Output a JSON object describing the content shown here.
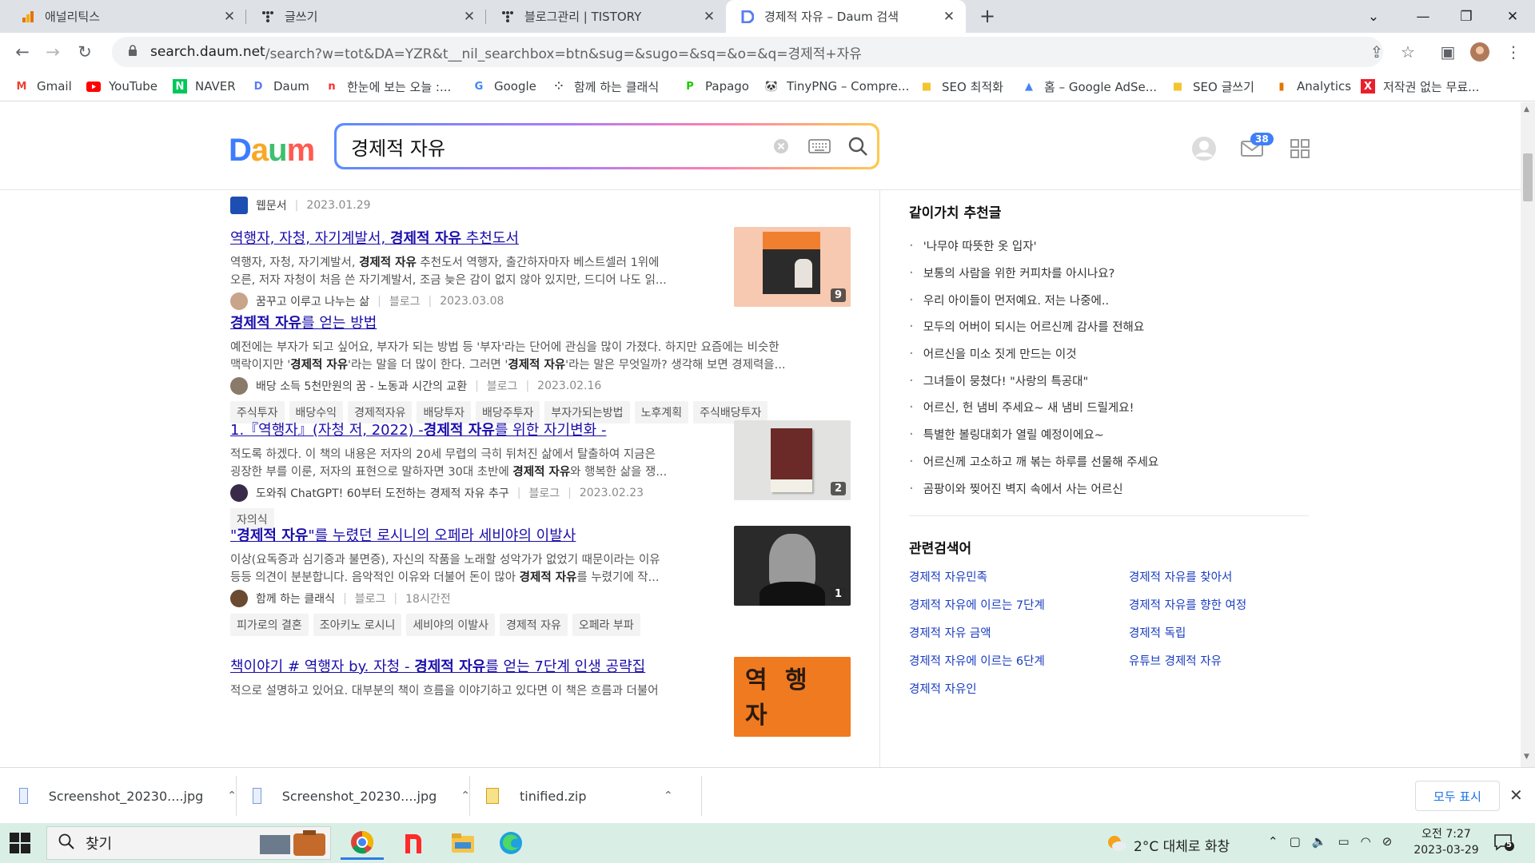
{
  "browser": {
    "tabs": [
      {
        "title": "애널리틱스",
        "active": false
      },
      {
        "title": "글쓰기",
        "active": false
      },
      {
        "title": "블로그관리 | TISTORY",
        "active": false
      },
      {
        "title": "경제적 자유 – Daum 검색",
        "active": true
      }
    ],
    "url_host": "search.daum.net",
    "url_rest": "/search?w=tot&DA=YZR&t__nil_searchbox=btn&sug=&sugo=&sq=&o=&q=경제적+자유",
    "bookmarks": [
      "Gmail",
      "YouTube",
      "NAVER",
      "Daum",
      "한눈에 보는 오늘 :...",
      "Google",
      "함께 하는 클래식",
      "Papago",
      "TinyPNG – Compre...",
      "SEO 최적화",
      "홈 – Google AdSe...",
      "SEO 글쓰기",
      "Analytics",
      "저작권 없는 무료..."
    ]
  },
  "daum": {
    "logo": "Daum",
    "query": "경제적 자유",
    "mail_count": "38"
  },
  "results": {
    "top_meta": {
      "source": "웹문서",
      "date": "2023.01.29"
    },
    "items": [
      {
        "title_pre": "역행자, 자청, 자기계발서, ",
        "title_bold": "경제적 자유",
        "title_post": " 추천도서",
        "desc_1_pre": "역행자, 자청, 자기계발서, ",
        "desc_1_bold": "경제적 자유",
        "desc_1_post": " 추천도서 역행자, 출간하자마자 베스트셀러 1위에",
        "desc_2": "오른, 저자 자청이 처음 쓴 자기계발서, 조금 늦은 감이 없지 않아 있지만, 드디어 나도 읽...",
        "author": "꿈꾸고 이루고 나누는 삶",
        "type": "블로그",
        "date": "2023.03.08",
        "count": "9"
      },
      {
        "title_bold": "경제적 자유",
        "title_post": "를 얻는 방법",
        "desc_1": "예전에는 부자가 되고 싶어요, 부자가 되는 방법 등 '부자'라는 단어에 관심을 많이 가졌다. 하지만 요즘에는 비슷한",
        "desc_2_pre": "맥락이지만 '",
        "desc_2_bold": "경제적 자유",
        "desc_2_mid": "'라는 말을 더 많이 한다. 그러면 '",
        "desc_2_bold2": "경제적 자유",
        "desc_2_post": "'라는 말은 무엇일까? 생각해 보면 경제력을...",
        "author": "배당 소득 5천만원의 꿈 - 노동과 시간의 교환",
        "type": "블로그",
        "date": "2023.02.16",
        "tags": [
          "주식투자",
          "배당수익",
          "경제적자유",
          "배당투자",
          "배당주투자",
          "부자가되는방법",
          "노후계획",
          "주식배당투자"
        ]
      },
      {
        "title_pre": "1.『역행자』(자청 저, 2022) -",
        "title_bold": "경제적 자유",
        "title_post": "를 위한 자기변화 -",
        "desc_1": "적도록 하겠다. 이 책의 내용은 저자의 20세 무렵의 극히 뒤처진 삶에서 탈출하여 지금은",
        "desc_2_pre": "굉장한 부를 이룬, 저자의 표현으로 말하자면 30대 초반에 ",
        "desc_2_bold": "경제적 자유",
        "desc_2_post": "와 행복한 삶을 쟁...",
        "author": "도와줘 ChatGPT! 60부터 도전하는 경제적 자유 추구",
        "type": "블로그",
        "date": "2023.02.23",
        "count": "2",
        "tags": [
          "자의식"
        ]
      },
      {
        "title_pre": "\"",
        "title_bold": "경제적 자유",
        "title_post": "\"를 누렸던 로시니의 오페라 세비야의 이발사",
        "desc_1": "이상(요독증과 심기증과 불면증), 자신의 작품을 노래할 성악가가 없었기 때문이라는 이유",
        "desc_2_pre": "등등 의견이 분분합니다. 음악적인 이유와 더불어 돈이 많아 ",
        "desc_2_bold": "경제적 자유",
        "desc_2_post": "를 누렸기에 작...",
        "author": "함께 하는 클래식",
        "type": "블로그",
        "date": "18시간전",
        "count": "1",
        "tags": [
          "피가로의 결혼",
          "조아키노 로시니",
          "세비야의 이발사",
          "경제적 자유",
          "오페라 부파"
        ]
      },
      {
        "title_pre": "책이야기 # 역행자 by. 자청 - ",
        "title_bold": "경제적 자유",
        "title_post": "를 얻는 7단계 인생 공략집",
        "desc_1": "적으로 설명하고 있어요. 대부분의 책이 흐름을 이야기하고 있다면 이 책은 흐름과 더불어"
      }
    ]
  },
  "recommend": {
    "heading": "같이가치 추천글",
    "items": [
      "'나무야 따뜻한 옷 입자'",
      "보통의 사람을 위한 커피차를 아시나요?",
      "우리 아이들이 먼저예요. 저는 나중에..",
      "모두의 어버이 되시는 어르신께 감사를 전해요",
      "어르신을 미소 짓게 만드는 이것",
      "그녀들이 뭉쳤다! \"사랑의 특공대\"",
      "어르신, 헌 냄비 주세요~ 새 냄비 드릴게요!",
      "특별한 볼링대회가 열릴 예정이에요~",
      "어르신께 고소하고 깨 볶는 하루를 선물해 주세요",
      "곰팡이와 찢어진 벽지 속에서 사는 어르신"
    ]
  },
  "related": {
    "heading": "관련검색어",
    "items": [
      "경제적 자유민족",
      "경제적 자유를 찾아서",
      "경제적 자유에 이르는 7단계",
      "경제적 자유를 향한 여정",
      "경제적 자유 금액",
      "경제적 독립",
      "경제적 자유에 이르는 6단계",
      "유튜브 경제적 자유",
      "경제적 자유인"
    ]
  },
  "downloads": {
    "items": [
      "Screenshot_20230....jpg",
      "Screenshot_20230....jpg",
      "tinified.zip"
    ],
    "show_all": "모두 표시"
  },
  "taskbar": {
    "search": "찾기",
    "weather": "2°C  대체로 화창",
    "time": "오전 7:27",
    "date": "2023-03-29",
    "notif_count": "5"
  },
  "colors": {
    "tab_strip": "#dee1e6",
    "link": "#1a0dab",
    "related_link": "#1a3dbf",
    "taskbar": "#d9efe6"
  }
}
